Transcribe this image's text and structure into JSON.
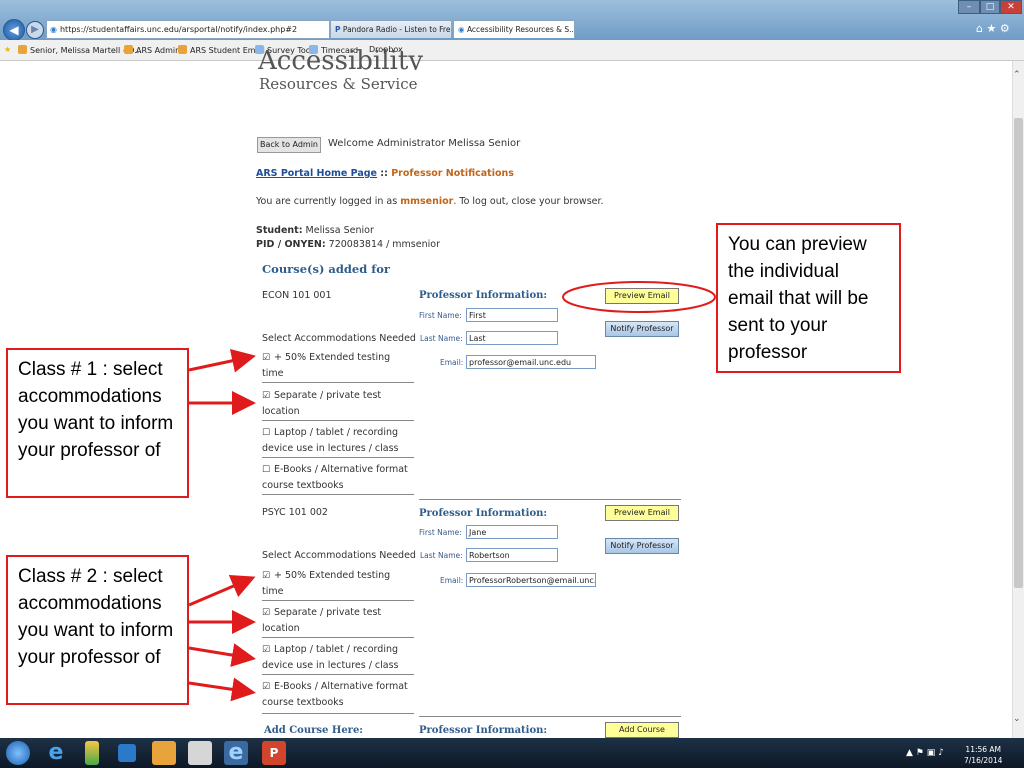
{
  "browser": {
    "address": "https://studentaffairs.unc.edu/arsportal/notify/index.php#2",
    "tabs": [
      "Pandora Radio - Listen to Free ...",
      "Accessibility Resources & S..."
    ],
    "bookmarks": [
      "Senior, Melissa Martell - O...",
      "ARS Admin",
      "ARS Student Email",
      "Survey Tool",
      "Timecard",
      "Dropbox"
    ]
  },
  "page": {
    "logo_line1": "Accessibility",
    "logo_line2": "Resources & Service",
    "back_button": "Back to Admin",
    "welcome": "Welcome Administrator Melissa Senior",
    "breadcrumb_home": "ARS Portal Home Page",
    "breadcrumb_sep": " :: ",
    "breadcrumb_current": "Professor Notifications",
    "logged_in_prefix": "You are currently logged in as ",
    "logged_in_user": "mmsenior",
    "logged_in_suffix": ". To log out, close your browser.",
    "student_label": "Student:",
    "student_name": "Melissa Senior",
    "pid_label": "PID / ONYEN:",
    "pid_value": "720083814 / mmsenior",
    "courses_heading": "Course(s) added for",
    "select_label": "Select Accommodations Needed",
    "prof_info_label": "Professor Information:",
    "first_name_label": "First Name:",
    "last_name_label": "Last Name:",
    "email_label": "Email:",
    "preview_button": "Preview Email",
    "notify_button": "Notify Professor",
    "add_course_label": "Add Course Here:",
    "add_course_button": "Add Course"
  },
  "accommodations": [
    "+ 50% Extended testing time",
    "Separate / private test location",
    "Laptop / tablet / recording device use in lectures / class",
    "E-Books / Alternative format course textbooks"
  ],
  "courses": [
    {
      "name": "ECON 101 001",
      "first": "First",
      "last": "Last",
      "email": "professor@email.unc.edu",
      "checked": [
        true,
        true,
        false,
        false
      ]
    },
    {
      "name": "PSYC 101 002",
      "first": "Jane",
      "last": "Robertson",
      "email": "ProfessorRobertson@email.unc.e",
      "checked": [
        true,
        true,
        true,
        true
      ]
    }
  ],
  "callouts": {
    "preview": "You can preview the individual email that will be sent to your professor",
    "class1": "Class # 1 : select accommodations you want to inform your professor of",
    "class2": "Class #  2 : select accommodations you want to inform your professor of"
  },
  "taskbar": {
    "time": "11:56 AM",
    "date": "7/16/2014"
  },
  "colors": {
    "link": "#1f4e99",
    "accent_orange": "#c0651a",
    "heading_blue": "#2e5d8c",
    "callout_red": "#e01b1b",
    "button_yellow": "#ffff99"
  }
}
